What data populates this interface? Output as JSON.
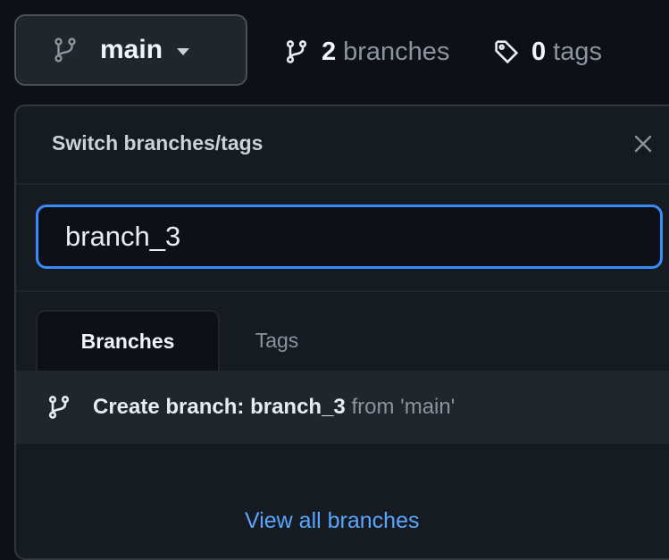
{
  "header": {
    "current_branch": "main",
    "branches_count": "2",
    "branches_label": "branches",
    "tags_count": "0",
    "tags_label": "tags"
  },
  "dropdown": {
    "title": "Switch branches/tags",
    "filter_value": "branch_3",
    "tabs": [
      {
        "label": "Branches",
        "active": true
      },
      {
        "label": "Tags",
        "active": false
      }
    ],
    "create_prefix": "Create branch: ",
    "create_name": "branch_3",
    "create_suffix": " from 'main'",
    "view_all": "View all branches"
  },
  "colors": {
    "accent": "#58a6ff",
    "focus_border": "#388bfd",
    "background": "#0d1117",
    "panel": "#161b22"
  },
  "icons": [
    "git-branch-icon",
    "tag-icon",
    "close-icon",
    "caret-down-icon"
  ]
}
